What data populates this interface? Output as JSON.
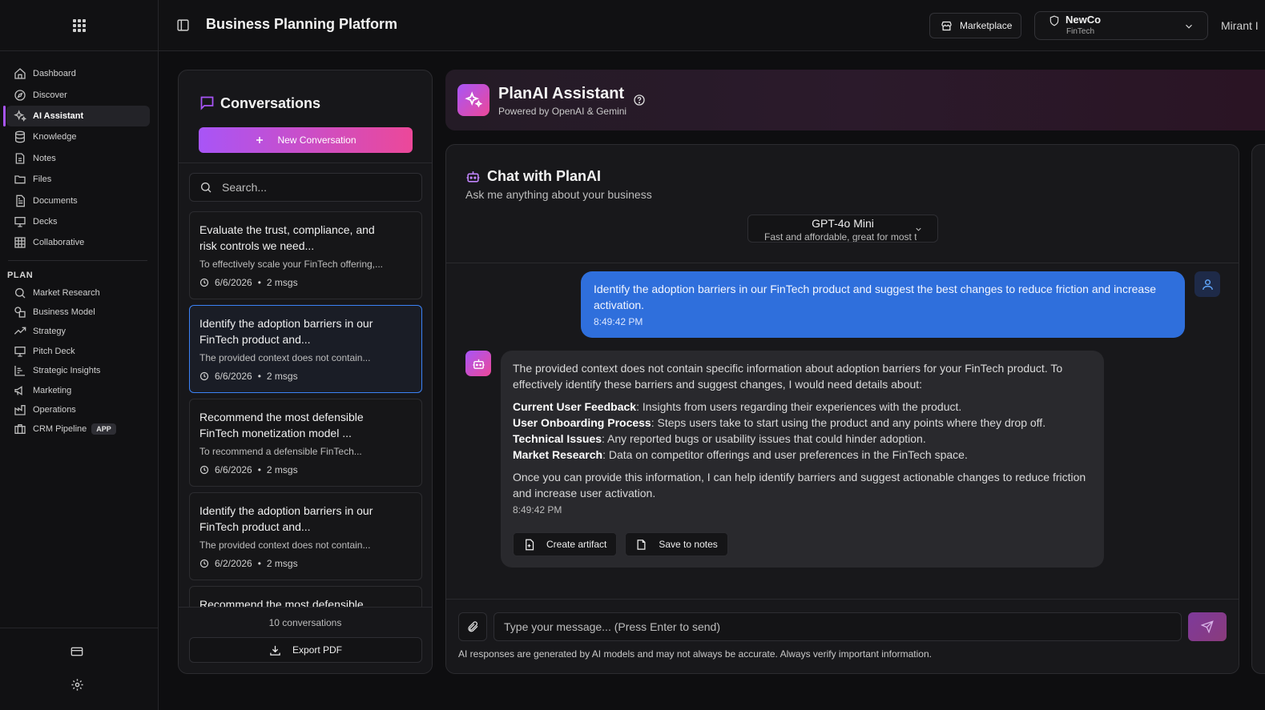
{
  "header": {
    "app_title": "Business Planning Platform",
    "marketplace_label": "Marketplace",
    "org_name": "NewCo",
    "org_sub": "FinTech",
    "user_name": "Mirant I"
  },
  "sidebar": {
    "items": [
      {
        "label": "Dashboard",
        "icon": "home-icon"
      },
      {
        "label": "Discover",
        "icon": "compass-icon"
      },
      {
        "label": "AI Assistant",
        "icon": "sparkles-icon",
        "active": true
      },
      {
        "label": "Knowledge",
        "icon": "database-icon"
      },
      {
        "label": "Notes",
        "icon": "note-icon"
      },
      {
        "label": "Files",
        "icon": "folder-icon"
      },
      {
        "label": "Documents",
        "icon": "document-icon"
      },
      {
        "label": "Decks",
        "icon": "presentation-icon"
      },
      {
        "label": "Collaborative",
        "icon": "grid-icon"
      }
    ],
    "plan_section": "PLAN",
    "plan_items": [
      {
        "label": "Market Research",
        "icon": "search-icon"
      },
      {
        "label": "Business Model",
        "icon": "shapes-icon"
      },
      {
        "label": "Strategy",
        "icon": "trending-icon"
      },
      {
        "label": "Pitch Deck",
        "icon": "presentation-icon"
      },
      {
        "label": "Strategic Insights",
        "icon": "bar-chart-icon"
      },
      {
        "label": "Marketing",
        "icon": "megaphone-icon"
      },
      {
        "label": "Operations",
        "icon": "factory-icon"
      },
      {
        "label": "CRM Pipeline",
        "icon": "briefcase-icon",
        "badge": "APP"
      }
    ]
  },
  "conversations": {
    "title": "Conversations",
    "new_label": "New Conversation",
    "search_placeholder": "Search...",
    "items": [
      {
        "title": "Evaluate the trust, compliance, and risk controls we need...",
        "snippet": "To effectively scale your FinTech offering,...",
        "date": "6/6/2026",
        "msgs": "2 msgs"
      },
      {
        "title": "Identify the adoption barriers in our FinTech product and...",
        "snippet": "The provided context does not contain...",
        "date": "6/6/2026",
        "msgs": "2 msgs",
        "selected": true
      },
      {
        "title": "Recommend the most defensible FinTech monetization model ...",
        "snippet": "To recommend a defensible FinTech...",
        "date": "6/6/2026",
        "msgs": "2 msgs"
      },
      {
        "title": "Identify the adoption barriers in our FinTech product and...",
        "snippet": "The provided context does not contain...",
        "date": "6/2/2026",
        "msgs": "2 msgs"
      },
      {
        "title": "Recommend the most defensible",
        "snippet": "",
        "date": "",
        "msgs": ""
      }
    ],
    "count": "10 conversations",
    "export_label": "Export PDF"
  },
  "assistant": {
    "title": "PlanAI Assistant",
    "subtitle": "Powered by OpenAI & Gemini"
  },
  "chat": {
    "title": "Chat with PlanAI",
    "subtitle": "Ask me anything about your business",
    "model_name": "GPT-4o Mini",
    "model_desc": "Fast and affordable, great for most tasks",
    "user_message": "Identify the adoption barriers in our FinTech product and suggest the best changes to reduce friction and increase activation.",
    "user_time": "8:49:42 PM",
    "bot_intro": "The provided context does not contain specific information about adoption barriers for your FinTech product. To effectively identify these barriers and suggest changes, I would need details about:",
    "bot_points": [
      {
        "label": "Current User Feedback",
        "text": ": Insights from users regarding their experiences with the product."
      },
      {
        "label": "User Onboarding Process",
        "text": ": Steps users take to start using the product and any points where they drop off."
      },
      {
        "label": "Technical Issues",
        "text": ": Any reported bugs or usability issues that could hinder adoption."
      },
      {
        "label": "Market Research",
        "text": ": Data on competitor offerings and user preferences in the FinTech space."
      }
    ],
    "bot_outro": "Once you can provide this information, I can help identify barriers and suggest actionable changes to reduce friction and increase user activation.",
    "bot_time": "8:49:42 PM",
    "create_artifact_label": "Create artifact",
    "save_notes_label": "Save to notes",
    "input_placeholder": "Type your message... (Press Enter to send)",
    "disclaimer": "AI responses are generated by AI models and may not always be accurate. Always verify important information."
  },
  "colors": {
    "accent_purple": "#a855f7",
    "accent_pink": "#ec4899",
    "user_bubble": "#2f6fdc",
    "selected_border": "#3b82f6"
  }
}
